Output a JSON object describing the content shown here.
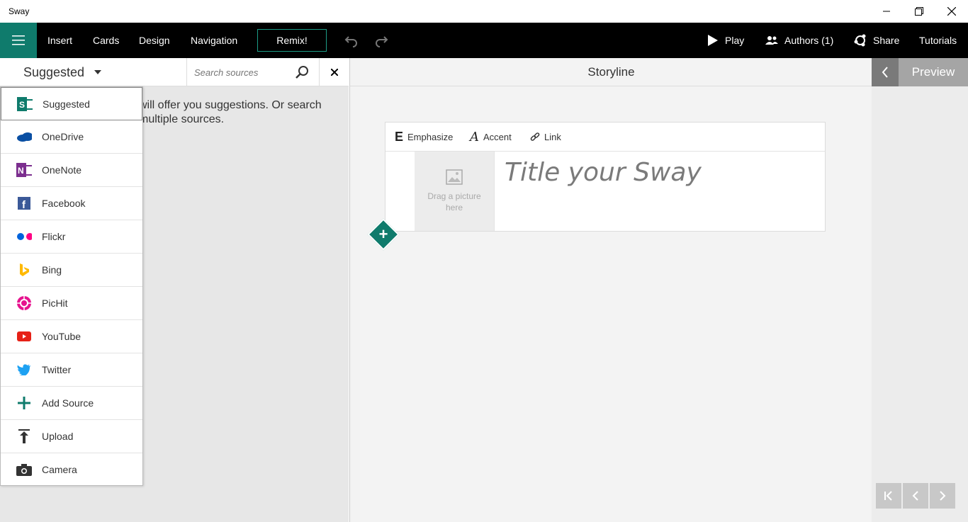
{
  "window": {
    "title": "Sway"
  },
  "ribbon": {
    "menu": [
      "Insert",
      "Cards",
      "Design",
      "Navigation"
    ],
    "remix_label": "Remix!",
    "play_label": "Play",
    "authors_label": "Authors (1)",
    "share_label": "Share",
    "tutorials_label": "Tutorials"
  },
  "left_pane": {
    "source_selected": "Suggested",
    "search_placeholder": "Search sources",
    "info_text": "will offer you suggestions. Or search\nmultiple sources.",
    "sources": [
      {
        "label": "Suggested",
        "icon": "sway-icon"
      },
      {
        "label": "OneDrive",
        "icon": "onedrive-icon"
      },
      {
        "label": "OneNote",
        "icon": "onenote-icon"
      },
      {
        "label": "Facebook",
        "icon": "facebook-icon"
      },
      {
        "label": "Flickr",
        "icon": "flickr-icon"
      },
      {
        "label": "Bing",
        "icon": "bing-icon"
      },
      {
        "label": "PicHit",
        "icon": "pichit-icon"
      },
      {
        "label": "YouTube",
        "icon": "youtube-icon"
      },
      {
        "label": "Twitter",
        "icon": "twitter-icon"
      },
      {
        "label": "Add Source",
        "icon": "plus-icon"
      },
      {
        "label": "Upload",
        "icon": "upload-icon"
      },
      {
        "label": "Camera",
        "icon": "camera-icon"
      }
    ]
  },
  "storyline": {
    "header": "Storyline",
    "toolbar": {
      "emphasize": "Emphasize",
      "accent": "Accent",
      "link": "Link"
    },
    "picture_placeholder": "Drag a picture here",
    "title_placeholder": "Title your Sway"
  },
  "preview": {
    "label": "Preview"
  },
  "colors": {
    "accent": "#0f7b6c",
    "ribbon": "#000000"
  }
}
